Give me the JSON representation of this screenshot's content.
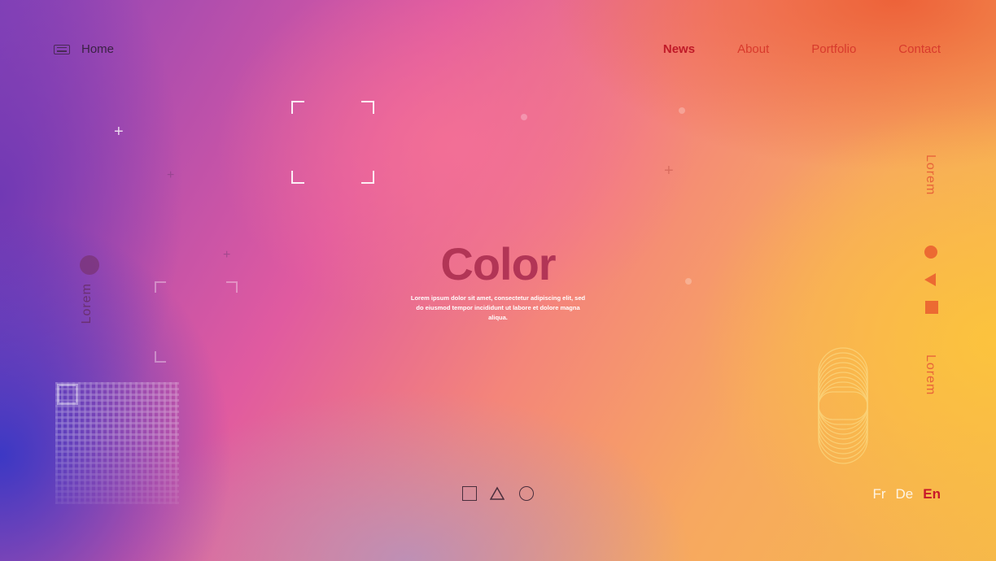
{
  "header": {
    "home_label": "Home",
    "nav": [
      {
        "label": "News",
        "active": true
      },
      {
        "label": "About",
        "active": false
      },
      {
        "label": "Portfolio",
        "active": false
      },
      {
        "label": "Contact",
        "active": false
      }
    ]
  },
  "hero": {
    "title": "Color",
    "description": "Lorem ipsum dolor sit amet, consectetur adipiscing elit, sed do eiusmod tempor incididunt ut labore et dolore magna aliqua."
  },
  "side_labels": {
    "left": "Lorem",
    "right_top": "Lorem",
    "right_bottom": "Lorem"
  },
  "shapes": [
    "square-icon",
    "triangle-icon",
    "circle-icon"
  ],
  "languages": [
    {
      "label": "Fr",
      "active": false
    },
    {
      "label": "De",
      "active": false
    },
    {
      "label": "En",
      "active": true
    }
  ],
  "colors": {
    "accent": "#c01a28",
    "title": "#b23556",
    "orange": "#ec6a32"
  }
}
